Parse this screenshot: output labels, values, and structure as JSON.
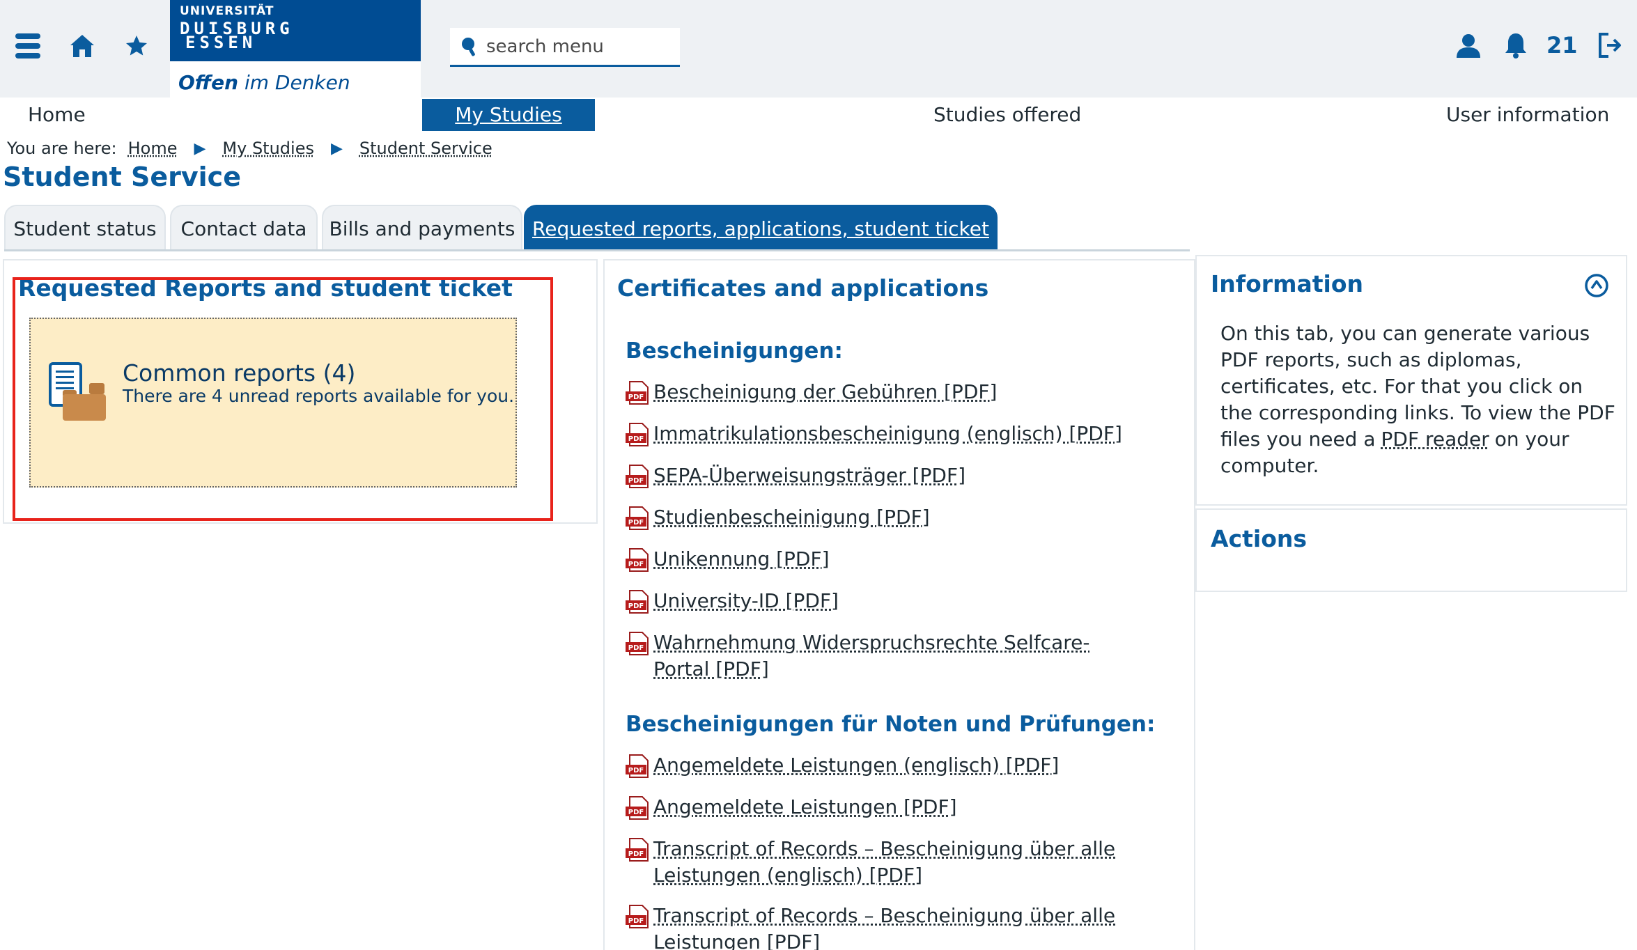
{
  "header": {
    "menu_icon": "hamburger-icon",
    "home_icon": "home-icon",
    "favorites_icon": "star-icon",
    "logo": {
      "line1": "UNIVERSITÄT",
      "line2": "DUISBURG",
      "line3": "ESSEN",
      "slogan_bold": "Offen",
      "slogan_rest": " im Denken"
    },
    "search": {
      "placeholder": "search menu"
    },
    "user_icon": "user-icon",
    "bell_icon": "bell-icon",
    "notification_count": "21",
    "logout_icon": "logout-icon",
    "accent": "#0a5c9e",
    "brand": "#004c93"
  },
  "mainnav": {
    "home": "Home",
    "my_studies": "My Studies",
    "studies_offered": "Studies offered",
    "user_information": "User information"
  },
  "breadcrumb": {
    "label": "You are here:",
    "items": [
      "Home",
      "My Studies",
      "Student Service"
    ]
  },
  "page_title": "Student Service",
  "tabs": [
    {
      "label": "Student status"
    },
    {
      "label": "Contact data"
    },
    {
      "label": "Bills and payments"
    },
    {
      "label": "Requested reports, applications, student ticket"
    }
  ],
  "reports_panel": {
    "title": "Requested Reports and student ticket",
    "card": {
      "title": "Common reports (4)",
      "subtitle": "There are 4 unread reports available for you.",
      "icon": "documents-folder-icon",
      "bg": "#fdedc6"
    }
  },
  "certificates_panel": {
    "title": "Certificates and applications",
    "section1": {
      "heading": "Bescheinigungen:",
      "links": [
        "Bescheinigung der Gebühren [PDF]",
        "Immatrikulationsbescheinigung (englisch) [PDF]",
        "SEPA-Überweisungsträger [PDF]",
        "Studienbescheinigung [PDF]",
        "Unikennung [PDF]",
        "University-ID [PDF]",
        "Wahrnehmung Widerspruchsrechte Selfcare-Portal [PDF]"
      ]
    },
    "section2": {
      "heading": "Bescheinigungen für Noten und Prüfungen:",
      "links": [
        "Angemeldete Leistungen (englisch) [PDF]",
        "Angemeldete Leistungen [PDF]",
        "Transcript of Records – Bescheinigung über alle Leistungen (englisch) [PDF]",
        "Transcript of Records – Bescheinigung über alle Leistungen [PDF]"
      ]
    }
  },
  "information_panel": {
    "title": "Information",
    "collapse_icon": "chevron-up-circle-icon",
    "text_before": "On this tab, you can generate various PDF reports, such as diplomas, certificates, etc. For that you click on the corresponding links. To view the PDF files you need a",
    "link": "PDF reader",
    "text_after": "on your computer."
  },
  "actions_panel": {
    "title": "Actions"
  }
}
